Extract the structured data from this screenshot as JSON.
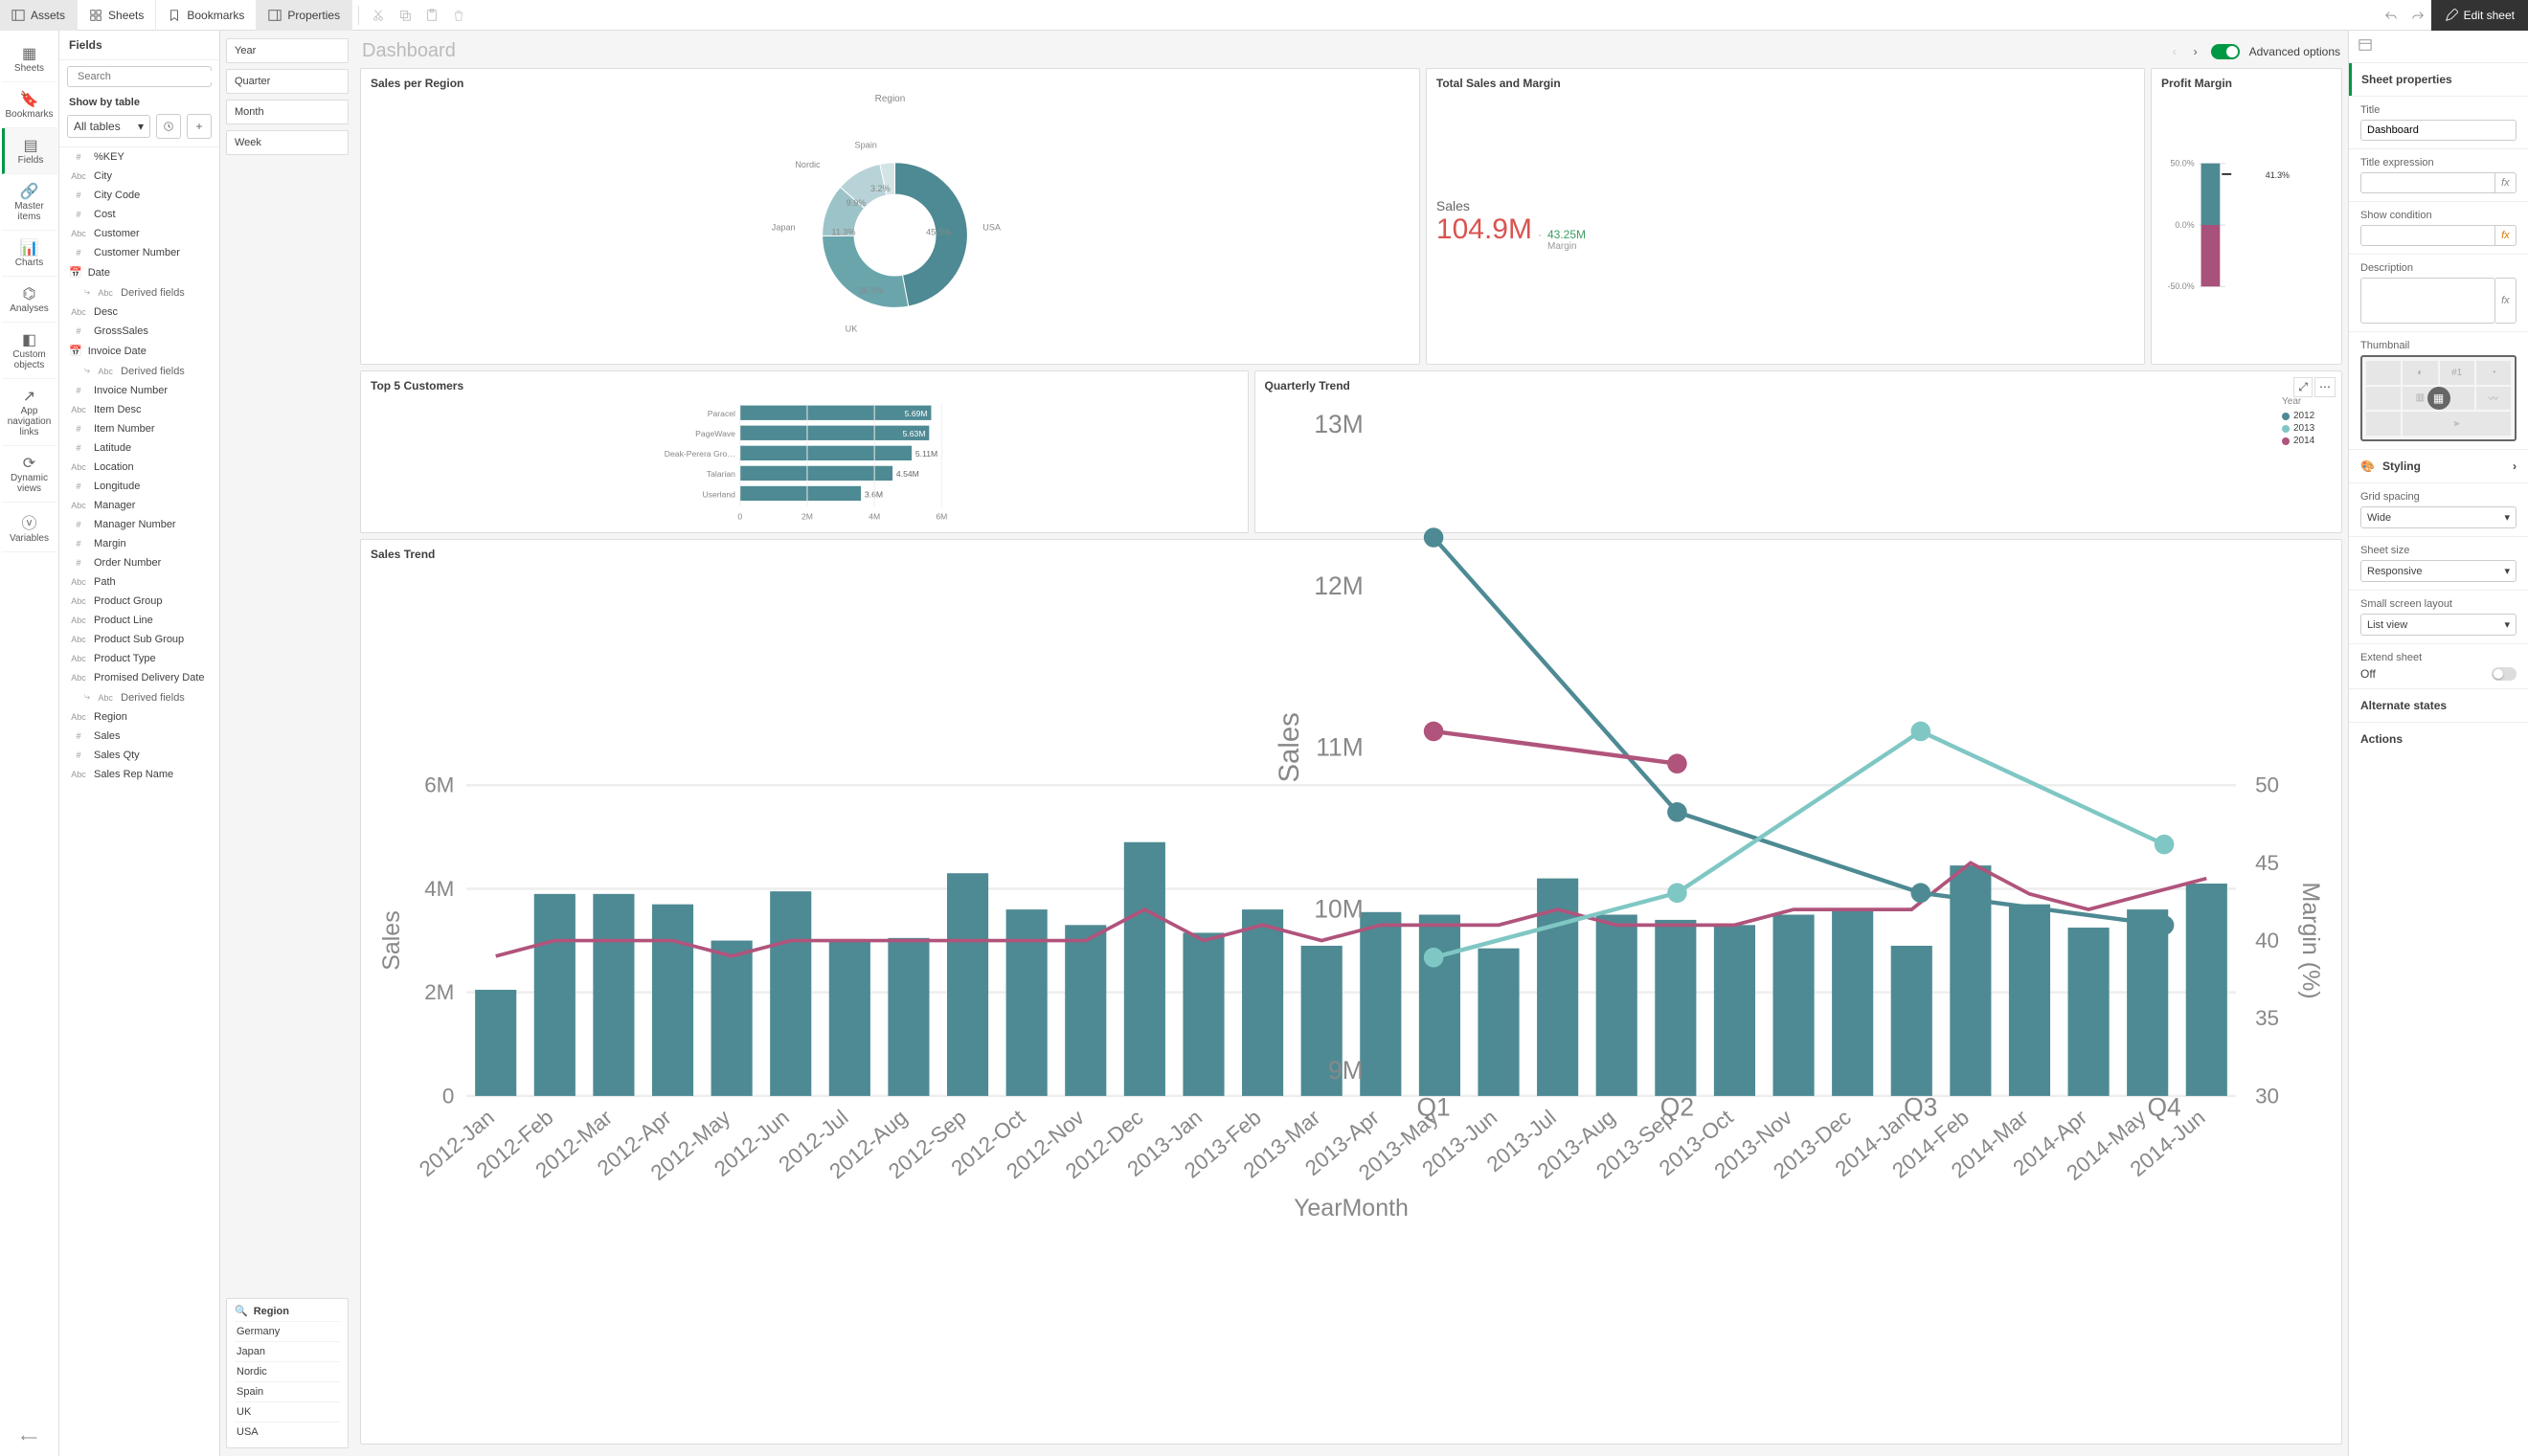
{
  "topbar": {
    "tabs": [
      {
        "icon": "panel",
        "label": "Assets"
      },
      {
        "icon": "grid",
        "label": "Sheets"
      },
      {
        "icon": "bookmark",
        "label": "Bookmarks"
      },
      {
        "icon": "panel",
        "label": "Properties"
      }
    ],
    "edit_sheet": "Edit sheet"
  },
  "rail": [
    {
      "label": "Sheets"
    },
    {
      "label": "Bookmarks"
    },
    {
      "label": "Fields",
      "active": true
    },
    {
      "label": "Master items"
    },
    {
      "label": "Charts"
    },
    {
      "label": "Analyses"
    },
    {
      "label": "Custom objects"
    },
    {
      "label": "App navigation links"
    },
    {
      "label": "Dynamic views"
    },
    {
      "label": "Variables"
    }
  ],
  "fieldspanel": {
    "title": "Fields",
    "search_placeholder": "Search",
    "show_by": "Show by table",
    "all_tables": "All tables",
    "fields": [
      {
        "type": "#",
        "name": "%KEY"
      },
      {
        "type": "Abc",
        "name": "City"
      },
      {
        "type": "#",
        "name": "City Code"
      },
      {
        "type": "#",
        "name": "Cost"
      },
      {
        "type": "Abc",
        "name": "Customer"
      },
      {
        "type": "#",
        "name": "Customer Number"
      },
      {
        "type": "date",
        "name": "Date"
      },
      {
        "type": "derived",
        "name": "Derived fields"
      },
      {
        "type": "Abc",
        "name": "Desc"
      },
      {
        "type": "#",
        "name": "GrossSales"
      },
      {
        "type": "date",
        "name": "Invoice Date"
      },
      {
        "type": "derived",
        "name": "Derived fields"
      },
      {
        "type": "#",
        "name": "Invoice Number"
      },
      {
        "type": "Abc",
        "name": "Item Desc"
      },
      {
        "type": "#",
        "name": "Item Number"
      },
      {
        "type": "#",
        "name": "Latitude"
      },
      {
        "type": "Abc",
        "name": "Location"
      },
      {
        "type": "#",
        "name": "Longitude"
      },
      {
        "type": "Abc",
        "name": "Manager"
      },
      {
        "type": "#",
        "name": "Manager Number"
      },
      {
        "type": "#",
        "name": "Margin"
      },
      {
        "type": "#",
        "name": "Order Number"
      },
      {
        "type": "Abc",
        "name": "Path"
      },
      {
        "type": "Abc",
        "name": "Product Group"
      },
      {
        "type": "Abc",
        "name": "Product Line"
      },
      {
        "type": "Abc",
        "name": "Product Sub Group"
      },
      {
        "type": "Abc",
        "name": "Product Type"
      },
      {
        "type": "Abc",
        "name": "Promised Delivery Date"
      },
      {
        "type": "derived",
        "name": "Derived fields"
      },
      {
        "type": "Abc",
        "name": "Region"
      },
      {
        "type": "#",
        "name": "Sales"
      },
      {
        "type": "#",
        "name": "Sales Qty"
      },
      {
        "type": "Abc",
        "name": "Sales Rep Name"
      }
    ]
  },
  "filters": {
    "collapsed": [
      "Year",
      "Quarter",
      "Month",
      "Week"
    ],
    "region": {
      "title": "Region",
      "items": [
        "Germany",
        "Japan",
        "Nordic",
        "Spain",
        "UK",
        "USA"
      ]
    }
  },
  "dashboard": {
    "title": "Dashboard",
    "advanced_options": "Advanced options"
  },
  "kpi": {
    "title": "Total Sales and Margin",
    "sales_label": "Sales",
    "sales_value": "104.9M",
    "margin_value": "43.25M",
    "margin_label": "Margin"
  },
  "profit_margin_card_title": "Profit Margin",
  "quarterly_card": {
    "title": "Quarterly Trend",
    "legend_title": "Year"
  },
  "salestrend_card_title": "Sales Trend",
  "top5_card_title": "Top 5 Customers",
  "salesregion_card": {
    "title": "Sales per Region",
    "dim": "Region"
  },
  "props": {
    "header": "Sheet properties",
    "title_label": "Title",
    "title_value": "Dashboard",
    "title_expr_label": "Title expression",
    "show_cond_label": "Show condition",
    "desc_label": "Description",
    "thumb_label": "Thumbnail",
    "thumb_hash": "#1",
    "styling": "Styling",
    "grid_label": "Grid spacing",
    "grid_value": "Wide",
    "size_label": "Sheet size",
    "size_value": "Responsive",
    "small_label": "Small screen layout",
    "small_value": "List view",
    "extend_label": "Extend sheet",
    "extend_value": "Off",
    "alt_states": "Alternate states",
    "actions": "Actions"
  },
  "chart_data": {
    "sales_per_region": {
      "type": "pie",
      "title": "Sales per Region",
      "dimension": "Region",
      "slices": [
        {
          "label": "USA",
          "value": 45.5,
          "color": "#4e8a93"
        },
        {
          "label": "UK",
          "value": 26.9,
          "color": "#6aa5ac"
        },
        {
          "label": "Japan",
          "value": 11.3,
          "color": "#9cc3c8"
        },
        {
          "label": "Nordic",
          "value": 9.9,
          "color": "#b8d3d7"
        },
        {
          "label": "Spain",
          "value": 3.2,
          "color": "#d3e4e6"
        }
      ]
    },
    "profit_margin": {
      "type": "bar",
      "title": "Profit Margin",
      "value_label": "41.3%",
      "segments": [
        {
          "from": 0,
          "to": 50,
          "color": "#4e8a93"
        },
        {
          "from": -50,
          "to": 0,
          "color": "#a8517a"
        }
      ],
      "yticks": [
        "-50.0%",
        "0.0%",
        "50.0%"
      ]
    },
    "top5_customers": {
      "type": "bar",
      "orientation": "horizontal",
      "title": "Top 5 Customers",
      "xlim": [
        0,
        6
      ],
      "xticks": [
        "0",
        "2M",
        "4M",
        "6M"
      ],
      "bars": [
        {
          "label": "Paracel",
          "value": 5.69,
          "text": "5.69M"
        },
        {
          "label": "PageWave",
          "value": 5.63,
          "text": "5.63M"
        },
        {
          "label": "Deak-Perera Gro…",
          "value": 5.11,
          "text": "5.11M"
        },
        {
          "label": "Talarian",
          "value": 4.54,
          "text": "4.54M"
        },
        {
          "label": "Userland",
          "value": 3.6,
          "text": "3.6M"
        }
      ]
    },
    "quarterly_trend": {
      "type": "line",
      "title": "Quarterly Trend",
      "xlabel": "",
      "ylabel": "Sales",
      "x": [
        "Q1",
        "Q2",
        "Q3",
        "Q4"
      ],
      "ylim": [
        9,
        13
      ],
      "yticks": [
        "9M",
        "10M",
        "11M",
        "12M",
        "13M"
      ],
      "legend_title": "Year",
      "series": [
        {
          "name": "2012",
          "color": "#4e8a93",
          "marker": "circle",
          "values": [
            12.3,
            10.6,
            10.1,
            9.9
          ]
        },
        {
          "name": "2013",
          "color": "#7fc7c4",
          "marker": "diamond",
          "values": [
            9.7,
            10.1,
            11.1,
            10.4
          ]
        },
        {
          "name": "2014",
          "color": "#b0547c",
          "marker": "triangle",
          "values": [
            11.1,
            10.9,
            null,
            null
          ]
        }
      ]
    },
    "sales_trend": {
      "type": "bar",
      "title": "Sales Trend",
      "xlabel": "YearMonth",
      "ylabel": "Sales",
      "y2label": "Margin (%)",
      "ylim": [
        0,
        6
      ],
      "y2lim": [
        30,
        50
      ],
      "yticks": [
        "0",
        "2M",
        "4M",
        "6M"
      ],
      "y2ticks": [
        "30",
        "35",
        "40",
        "45",
        "50"
      ],
      "categories": [
        "2012-Jan",
        "2012-Feb",
        "2012-Mar",
        "2012-Apr",
        "2012-May",
        "2012-Jun",
        "2012-Jul",
        "2012-Aug",
        "2012-Sep",
        "2012-Oct",
        "2012-Nov",
        "2012-Dec",
        "2013-Jan",
        "2013-Feb",
        "2013-Mar",
        "2013-Apr",
        "2013-May",
        "2013-Jun",
        "2013-Jul",
        "2013-Aug",
        "2013-Sep",
        "2013-Oct",
        "2013-Nov",
        "2013-Dec",
        "2014-Jan",
        "2014-Feb",
        "2014-Mar",
        "2014-Apr",
        "2014-May",
        "2014-Jun"
      ],
      "bars": [
        2.05,
        3.9,
        3.9,
        3.7,
        3.0,
        3.95,
        3.0,
        3.05,
        4.3,
        3.6,
        3.3,
        4.9,
        3.15,
        3.6,
        2.9,
        3.55,
        3.5,
        2.85,
        4.2,
        3.5,
        3.4,
        3.3,
        3.5,
        3.6,
        2.9,
        4.45,
        3.7,
        3.25,
        3.6,
        4.1
      ],
      "margin_line": [
        39,
        40,
        40,
        40,
        39,
        40,
        40,
        40,
        40,
        40,
        40,
        42,
        40,
        41,
        40,
        41,
        41,
        41,
        42,
        41,
        41,
        41,
        42,
        42,
        42,
        45,
        43,
        42,
        43,
        44
      ]
    }
  }
}
